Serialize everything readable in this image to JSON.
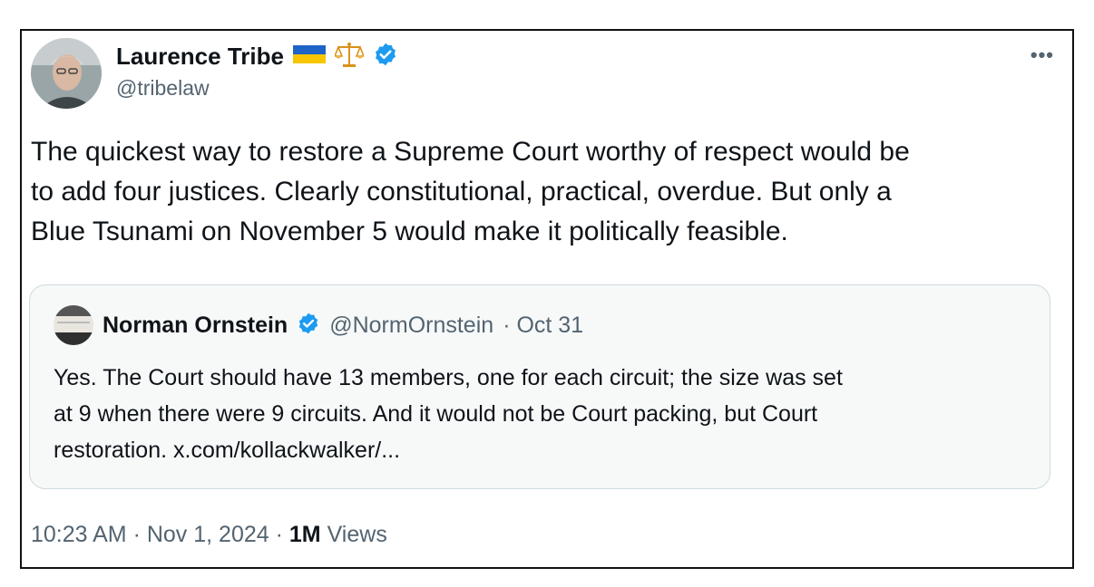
{
  "tweet": {
    "author_name": "Laurence Tribe",
    "author_handle": "@tribelaw",
    "more_label": "•••",
    "text_lines": [
      "The quickest way to restore a Supreme Court worthy of respect would be",
      "to add four justices. Clearly constitutional, practical, overdue. But only a",
      "Blue Tsunami on November 5 would make it politically feasible."
    ],
    "icons": [
      "ukraine-flag-icon",
      "scales-icon",
      "verified-badge-icon",
      "more-options-icon"
    ]
  },
  "quote": {
    "author_name": "Norman Ornstein",
    "author_handle": "@NormOrnstein",
    "date": "· Oct 31",
    "text_lines": [
      "Yes. The Court should have 13 members, one for each circuit; the size was set",
      "at 9 when there were 9 circuits. And it would not be Court packing, but Court",
      "restoration. x.com/kollackwalker/..."
    ]
  },
  "footer": {
    "timestamp": "10:23 AM · Nov 1, 2024 ·",
    "views_count": "1M",
    "views_label": "Views"
  },
  "colors": {
    "verified": "#1d9bf0",
    "secondary_text": "#536471",
    "primary_text": "#0f1419",
    "quote_bg": "#f7f9f9",
    "quote_border": "#cfd9de"
  }
}
